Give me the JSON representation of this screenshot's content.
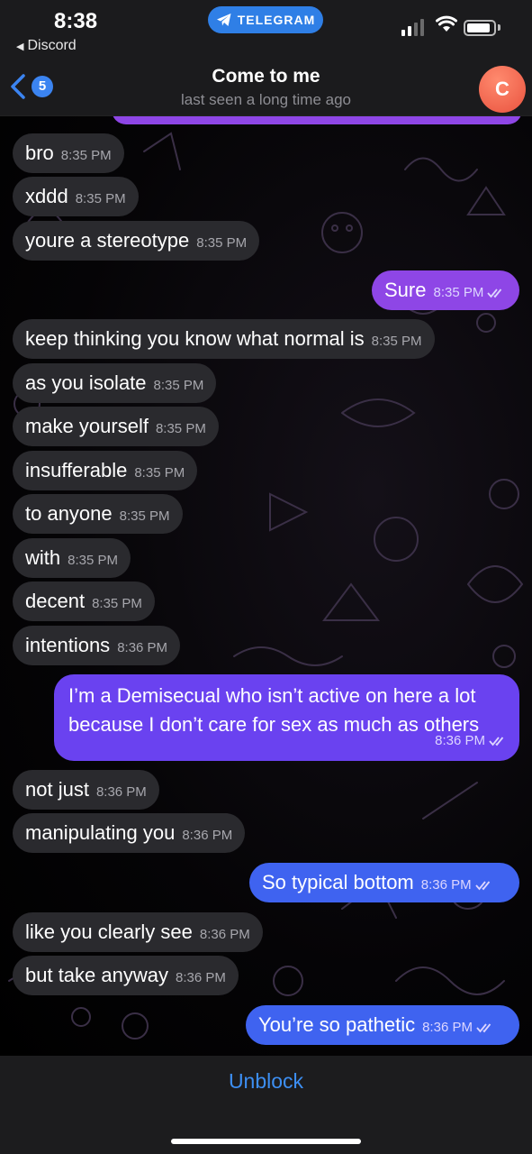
{
  "status_bar": {
    "time": "8:38",
    "back_app": "Discord",
    "pill_label": "TELEGRAM",
    "battery_level": 0.9
  },
  "header": {
    "back_badge": "5",
    "title": "Come to me",
    "subtitle": "last seen a long time ago",
    "avatar_letter": "C"
  },
  "colors": {
    "incoming_bubble": "#2a2a2e",
    "outgoing_purple": "#8e46e6",
    "outgoing_violet": "#6a42f0",
    "outgoing_blue": "#3f63f0",
    "accent_blue": "#3d8ff3",
    "avatar": "#e9533f"
  },
  "messages": [
    {
      "dir": "in",
      "text": "bro",
      "time": "8:35 PM"
    },
    {
      "dir": "in",
      "text": "xddd",
      "time": "8:35 PM"
    },
    {
      "dir": "in",
      "text": "youre a stereotype",
      "time": "8:35 PM"
    },
    {
      "dir": "out",
      "text": "Sure",
      "time": "8:35 PM",
      "read": true
    },
    {
      "dir": "in",
      "text": "keep thinking you know what normal is",
      "time": "8:35 PM"
    },
    {
      "dir": "in",
      "text": "as you isolate",
      "time": "8:35 PM"
    },
    {
      "dir": "in",
      "text": "make yourself",
      "time": "8:35 PM"
    },
    {
      "dir": "in",
      "text": "insufferable",
      "time": "8:35 PM"
    },
    {
      "dir": "in",
      "text": "to anyone",
      "time": "8:35 PM"
    },
    {
      "dir": "in",
      "text": "with",
      "time": "8:35 PM"
    },
    {
      "dir": "in",
      "text": "decent",
      "time": "8:35 PM"
    },
    {
      "dir": "in",
      "text": "intentions",
      "time": "8:36 PM"
    },
    {
      "dir": "out",
      "text": "I’m a Demisecual who isn’t active on here a lot because I don’t care for sex as much as others",
      "time": "8:36 PM",
      "read": true
    },
    {
      "dir": "in",
      "text": "not just",
      "time": "8:36 PM"
    },
    {
      "dir": "in",
      "text": "manipulating you",
      "time": "8:36 PM"
    },
    {
      "dir": "out",
      "text": "So typical bottom",
      "time": "8:36 PM",
      "read": true
    },
    {
      "dir": "in",
      "text": "like you clearly see",
      "time": "8:36 PM"
    },
    {
      "dir": "in",
      "text": "but take anyway",
      "time": "8:36 PM"
    },
    {
      "dir": "out",
      "text": "You’re so pathetic",
      "time": "8:36 PM",
      "read": true
    }
  ],
  "footer": {
    "unblock_label": "Unblock"
  }
}
